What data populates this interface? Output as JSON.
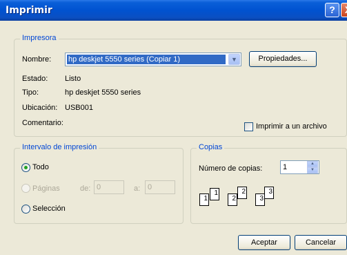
{
  "window": {
    "title": "Imprimir",
    "help_label": "?",
    "close_label": "X"
  },
  "printer": {
    "legend": "Impresora",
    "name_label": "Nombre:",
    "name_value": "hp deskjet 5550 series (Copiar 1)",
    "properties_label": "Propiedades...",
    "status_label": "Estado:",
    "status_value": "Listo",
    "type_label": "Tipo:",
    "type_value": "hp deskjet 5550 series",
    "location_label": "Ubicación:",
    "location_value": "USB001",
    "comment_label": "Comentario:",
    "print_to_file_label": "Imprimir a un archivo"
  },
  "range": {
    "legend": "Intervalo de impresión",
    "all_label": "Todo",
    "pages_label": "Páginas",
    "from_label": "de:",
    "from_value": "0",
    "to_label": "a:",
    "to_value": "0",
    "selection_label": "Selección"
  },
  "copies": {
    "legend": "Copias",
    "count_label": "Número de copias:",
    "count_value": "1",
    "collate_pages": [
      "1",
      "1",
      "2",
      "2",
      "3",
      "3"
    ]
  },
  "footer": {
    "ok_label": "Aceptar",
    "cancel_label": "Cancelar"
  }
}
